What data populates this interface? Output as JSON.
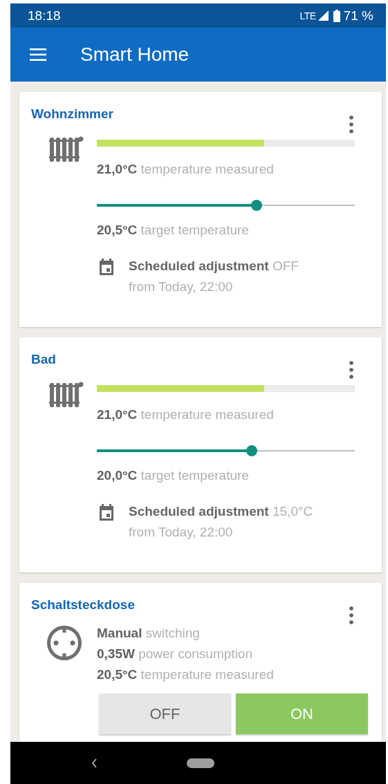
{
  "status_bar": {
    "time": "18:18",
    "network": "LTE",
    "battery": "71 %"
  },
  "app_bar": {
    "title": "Smart Home"
  },
  "devices": [
    {
      "kind": "radiator",
      "name": "Wohnzimmer",
      "measured": {
        "level": 0.65,
        "text": "**21,0°C** temperature measured"
      },
      "target": {
        "level": 0.62,
        "text": "**20,5°C** target temperature"
      },
      "schedule": [
        "**Scheduled adjustment** OFF",
        "from Today, 22:00"
      ]
    },
    {
      "kind": "radiator",
      "name": "Bad",
      "measured": {
        "level": 0.65,
        "text": "**21,0°C** temperature measured"
      },
      "target": {
        "level": 0.6,
        "text": "**20,0°C** target temperature"
      },
      "schedule": [
        "**Scheduled adjustment** 15,0°C",
        "from Today, 22:00"
      ]
    },
    {
      "kind": "socket",
      "name": "Schaltsteckdose",
      "lines": [
        "**Manual** switching",
        "**0,35W** power consumption",
        "**20,5°C** temperature measured"
      ],
      "buttons": [
        {
          "label": "OFF",
          "selected": false
        },
        {
          "label": "ON",
          "selected": true
        }
      ]
    }
  ]
}
